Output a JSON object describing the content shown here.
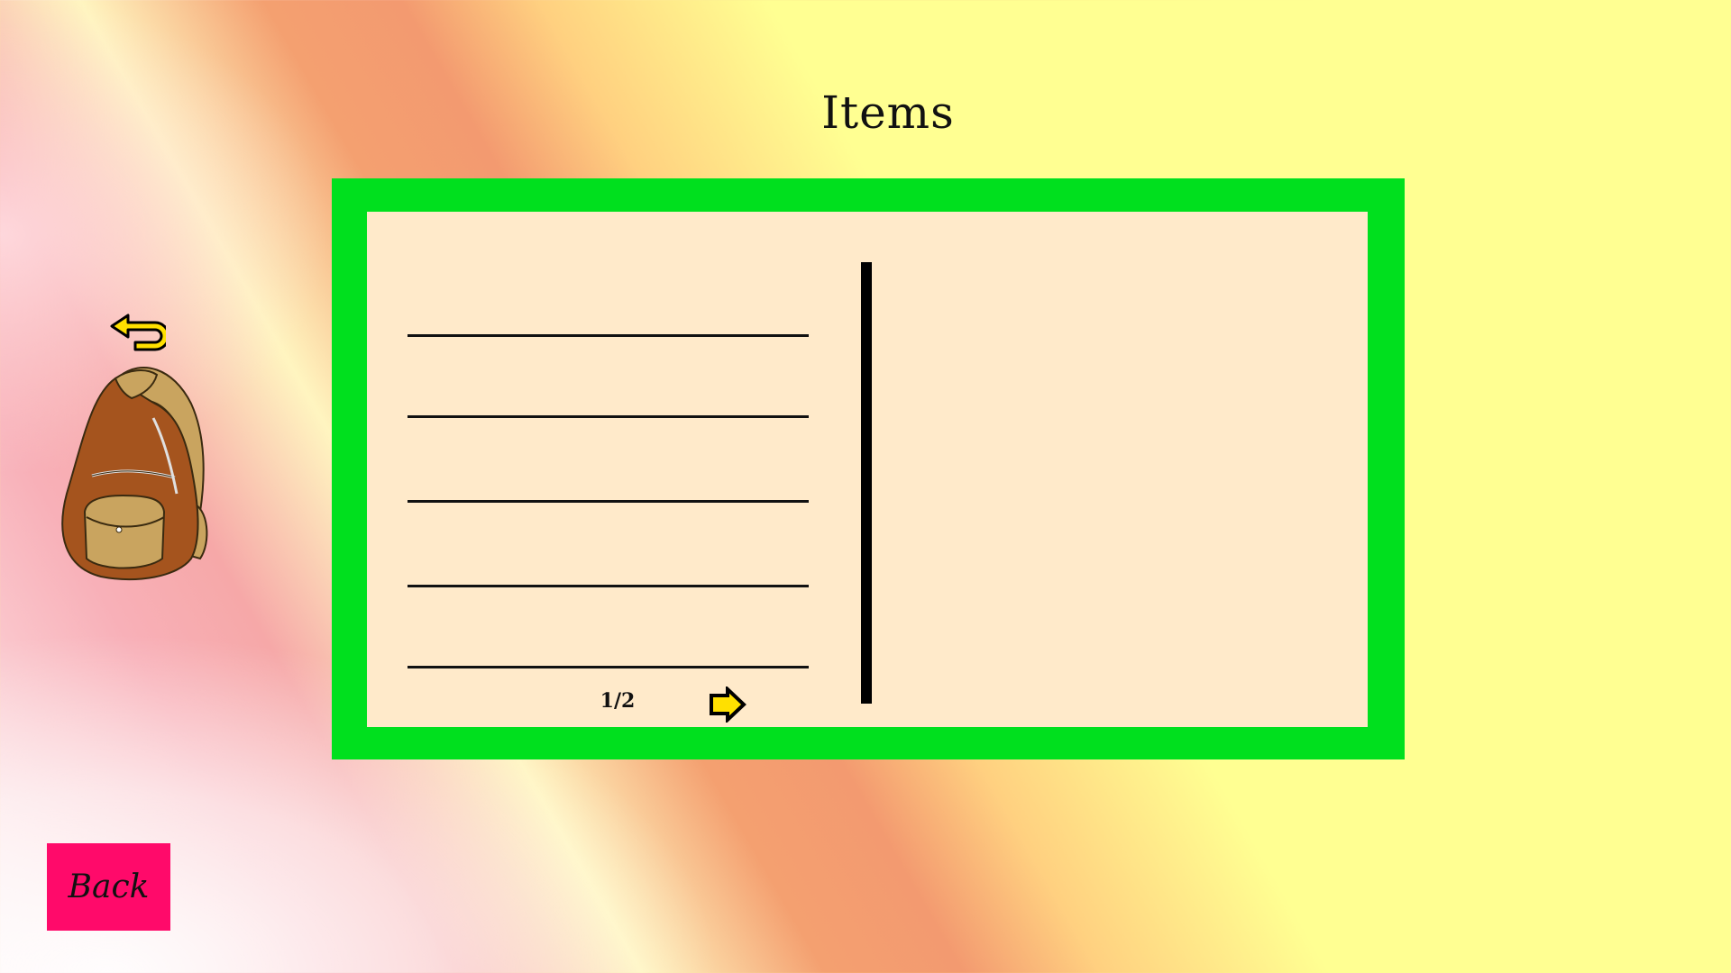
{
  "screen": {
    "title": "Items"
  },
  "inventory": {
    "page_indicator": "1/2",
    "slots": [
      "",
      "",
      "",
      "",
      ""
    ],
    "details_text": ""
  },
  "icons": {
    "undo": "undo-arrow-icon",
    "backpack": "backpack-icon",
    "next_page": "next-page-arrow-icon"
  },
  "footer": {
    "back_label": "Back"
  },
  "colors": {
    "panel_border": "#00e01e",
    "panel_fill": "#ffeaca",
    "back_button": "#ff0a6a",
    "arrow_fill": "#ffe000"
  }
}
